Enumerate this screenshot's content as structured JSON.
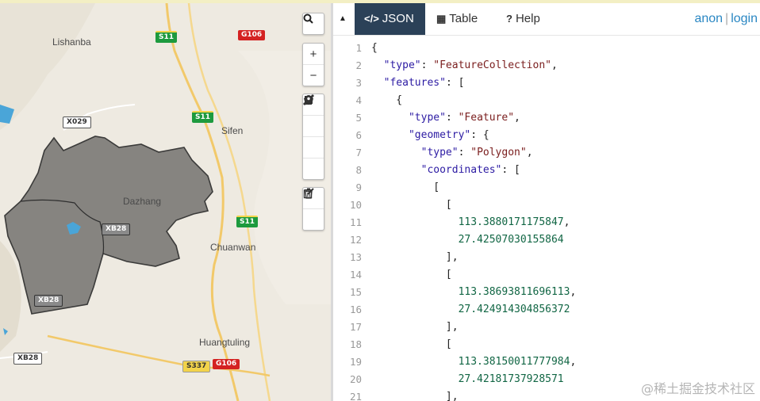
{
  "map": {
    "places": [
      "Lishanba",
      "Sifen",
      "Dazhang",
      "Chuanwan",
      "Huangtuling"
    ],
    "shields": [
      {
        "label": "S11",
        "color": "green"
      },
      {
        "label": "G106",
        "color": "red"
      },
      {
        "label": "X029",
        "color": "white"
      },
      {
        "label": "S11",
        "color": "green"
      },
      {
        "label": "S11",
        "color": "green"
      },
      {
        "label": "XB28",
        "color": "gray"
      },
      {
        "label": "XB28",
        "color": "gray"
      },
      {
        "label": "XB28",
        "color": "white"
      },
      {
        "label": "S337",
        "color": "yellow"
      },
      {
        "label": "G106",
        "color": "red"
      }
    ],
    "controls": {
      "search": "search-icon",
      "zoom_in": "+",
      "zoom_out": "−",
      "tools": [
        "draw-line-icon",
        "draw-polygon-icon",
        "draw-rectangle-icon",
        "draw-marker-icon",
        "edit-icon",
        "delete-icon"
      ]
    },
    "colors": {
      "polygon_fill": "#7f7d79",
      "polygon_stroke": "#2e2e2e",
      "road": "#f2c96a",
      "water": "#4aa5d8"
    }
  },
  "panel": {
    "tabs": [
      {
        "icon": "</>",
        "label": "JSON",
        "active": true
      },
      {
        "icon": "▦",
        "label": "Table",
        "active": false
      },
      {
        "icon": "?",
        "label": "Help",
        "active": false
      }
    ],
    "auth": {
      "anon": "anon",
      "sep": "|",
      "login": "login"
    },
    "accent": "#2b4158"
  },
  "code_lines": [
    {
      "n": "1",
      "t": "{"
    },
    {
      "n": "2",
      "t": "  \"type\": \"FeatureCollection\","
    },
    {
      "n": "3",
      "t": "  \"features\": ["
    },
    {
      "n": "4",
      "t": "    {"
    },
    {
      "n": "5",
      "t": "      \"type\": \"Feature\","
    },
    {
      "n": "6",
      "t": "      \"geometry\": {"
    },
    {
      "n": "7",
      "t": "        \"type\": \"Polygon\","
    },
    {
      "n": "8",
      "t": "        \"coordinates\": ["
    },
    {
      "n": "9",
      "t": "          ["
    },
    {
      "n": "10",
      "t": "            ["
    },
    {
      "n": "11",
      "t": "              113.3880171175847,"
    },
    {
      "n": "12",
      "t": "              27.42507030155864"
    },
    {
      "n": "13",
      "t": "            ],"
    },
    {
      "n": "14",
      "t": "            ["
    },
    {
      "n": "15",
      "t": "              113.38693811696113,"
    },
    {
      "n": "16",
      "t": "              27.424914304856372"
    },
    {
      "n": "17",
      "t": "            ],"
    },
    {
      "n": "18",
      "t": "            ["
    },
    {
      "n": "19",
      "t": "              113.38150011777984,"
    },
    {
      "n": "20",
      "t": "              27.42181737928571"
    },
    {
      "n": "21",
      "t": "            ],"
    }
  ],
  "watermark": "@稀土掘金技术社区"
}
